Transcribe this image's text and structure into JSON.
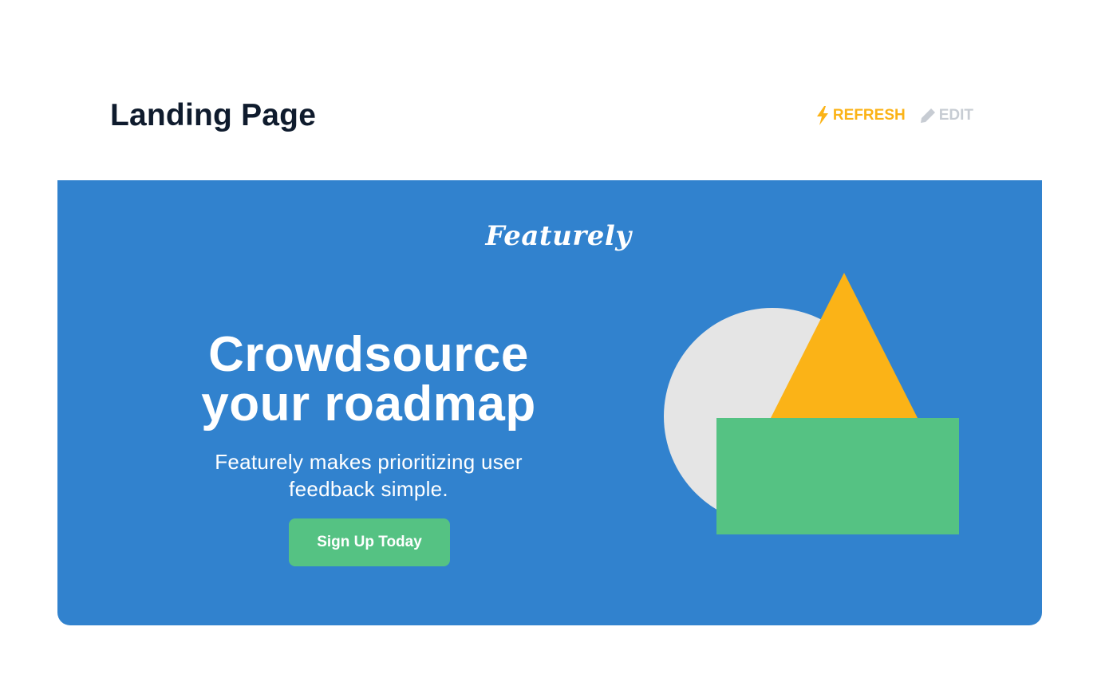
{
  "header": {
    "title": "Landing Page",
    "actions": {
      "refresh": {
        "label": "REFRESH",
        "icon": "lightning-bolt-icon",
        "color": "#fbb317"
      },
      "edit": {
        "label": "EDIT",
        "icon": "pencil-icon",
        "color": "#c7ccd3"
      }
    }
  },
  "hero": {
    "background_color": "#3182ce",
    "brand": "Featurely",
    "headline_line1": "Crowdsource",
    "headline_line2": "your roadmap",
    "subhead": "Featurely makes prioritizing user feedback simple.",
    "cta_label": "Sign Up Today",
    "cta_color": "#55c283",
    "illustration": {
      "circle_color": "#e5e5e5",
      "triangle_color": "#fbb317",
      "rectangle_color": "#55c283"
    }
  }
}
